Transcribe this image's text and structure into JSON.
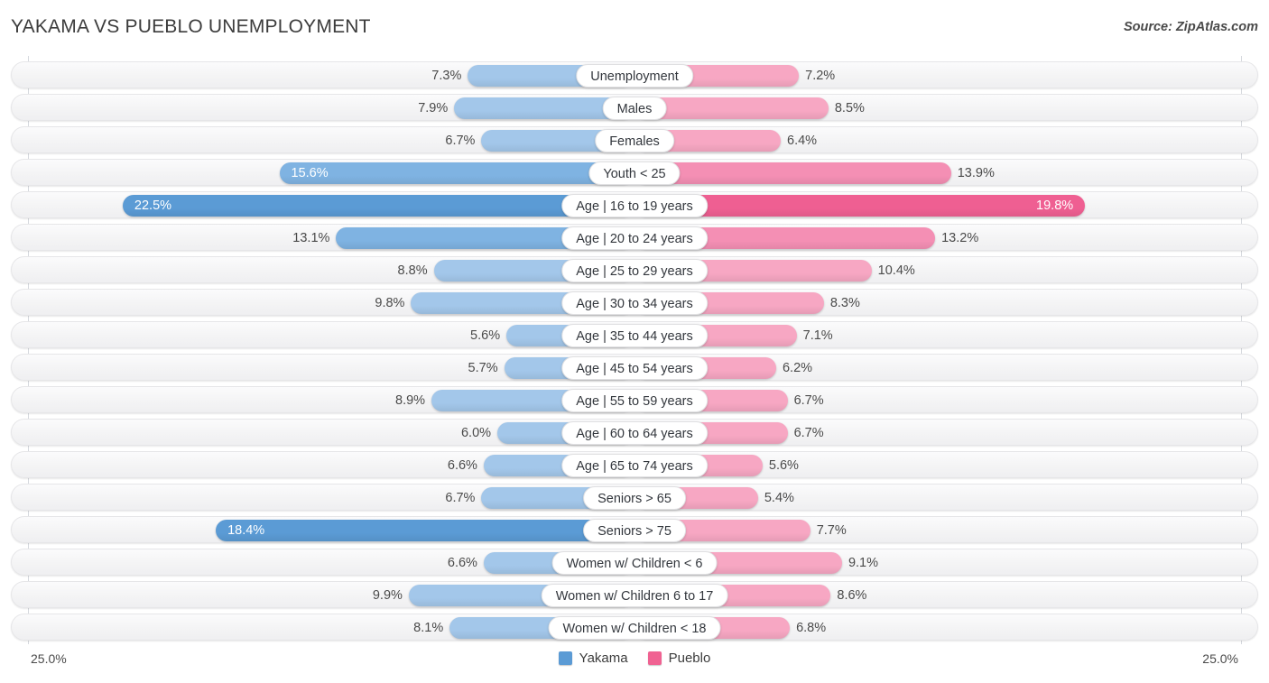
{
  "header": {
    "title": "YAKAMA VS PUEBLO UNEMPLOYMENT",
    "source": "Source: ZipAtlas.com"
  },
  "axis": {
    "min_label": "25.0%",
    "max_label": "25.0%",
    "max_value": 25.0
  },
  "legend": {
    "items": [
      {
        "name": "Yakama",
        "color": "#5b9bd5"
      },
      {
        "name": "Pueblo",
        "color": "#f06292"
      }
    ]
  },
  "colors": {
    "left_light": "#a3c7ea",
    "left_mid": "#7fb3e2",
    "left_strong": "#5b9bd5",
    "right_light": "#f7a7c3",
    "right_mid": "#f48fb4",
    "right_strong": "#ef5f92",
    "row_bg": "#f4f4f5",
    "gridline": "#d6d9de",
    "text": "#4a4a4a"
  },
  "chart_data": {
    "type": "bar",
    "orientation": "horizontal-diverging",
    "title": "YAKAMA VS PUEBLO UNEMPLOYMENT",
    "xlabel": "",
    "ylabel": "",
    "xlim": [
      25.0,
      25.0
    ],
    "grid": true,
    "legend_position": "bottom-center",
    "categories": [
      "Unemployment",
      "Males",
      "Females",
      "Youth < 25",
      "Age | 16 to 19 years",
      "Age | 20 to 24 years",
      "Age | 25 to 29 years",
      "Age | 30 to 34 years",
      "Age | 35 to 44 years",
      "Age | 45 to 54 years",
      "Age | 55 to 59 years",
      "Age | 60 to 64 years",
      "Age | 65 to 74 years",
      "Seniors > 65",
      "Seniors > 75",
      "Women w/ Children < 6",
      "Women w/ Children 6 to 17",
      "Women w/ Children < 18"
    ],
    "series": [
      {
        "name": "Yakama",
        "color": "#5b9bd5",
        "values": [
          7.3,
          7.9,
          6.7,
          15.6,
          22.5,
          13.1,
          8.8,
          9.8,
          5.6,
          5.7,
          8.9,
          6.0,
          6.6,
          6.7,
          18.4,
          6.6,
          9.9,
          8.1
        ],
        "labels": [
          "7.3%",
          "7.9%",
          "6.7%",
          "15.6%",
          "22.5%",
          "13.1%",
          "8.8%",
          "9.8%",
          "5.6%",
          "5.7%",
          "8.9%",
          "6.0%",
          "6.6%",
          "6.7%",
          "18.4%",
          "6.6%",
          "9.9%",
          "8.1%"
        ]
      },
      {
        "name": "Pueblo",
        "color": "#f06292",
        "values": [
          7.2,
          8.5,
          6.4,
          13.9,
          19.8,
          13.2,
          10.4,
          8.3,
          7.1,
          6.2,
          6.7,
          6.7,
          5.6,
          5.4,
          7.7,
          9.1,
          8.6,
          6.8
        ],
        "labels": [
          "7.2%",
          "8.5%",
          "6.4%",
          "13.9%",
          "19.8%",
          "13.2%",
          "10.4%",
          "8.3%",
          "7.1%",
          "6.2%",
          "6.7%",
          "6.7%",
          "5.6%",
          "5.4%",
          "7.7%",
          "9.1%",
          "8.6%",
          "6.8%"
        ]
      }
    ]
  }
}
